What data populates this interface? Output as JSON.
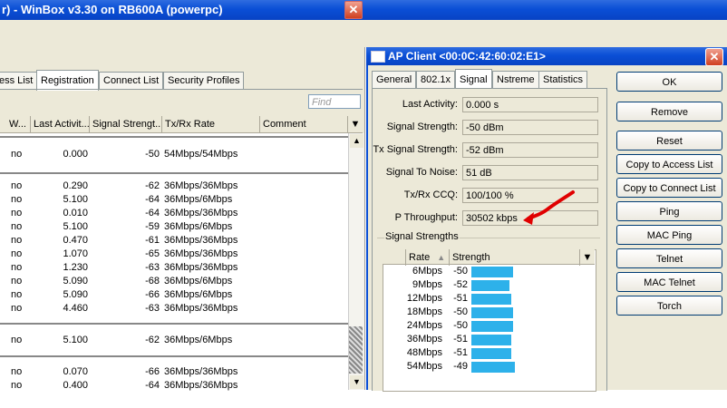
{
  "main_window": {
    "title": "r) - WinBox v3.30 on RB600A (powerpc)"
  },
  "left_window": {
    "tabs": [
      "ess List",
      "Registration",
      "Connect List",
      "Security Profiles"
    ],
    "active_tab": "Registration",
    "find_placeholder": "Find",
    "columns": [
      "W...",
      "Last Activit...",
      "Signal Strengt...",
      "Tx/Rx Rate",
      "Comment"
    ],
    "rows": [
      {
        "w": "no",
        "last": "0.000",
        "sig": "-50",
        "rate": "54Mbps/54Mbps"
      },
      {
        "w": "no",
        "last": "0.290",
        "sig": "-62",
        "rate": "36Mbps/36Mbps"
      },
      {
        "w": "no",
        "last": "5.100",
        "sig": "-64",
        "rate": "36Mbps/6Mbps"
      },
      {
        "w": "no",
        "last": "0.010",
        "sig": "-64",
        "rate": "36Mbps/36Mbps"
      },
      {
        "w": "no",
        "last": "5.100",
        "sig": "-59",
        "rate": "36Mbps/6Mbps"
      },
      {
        "w": "no",
        "last": "0.470",
        "sig": "-61",
        "rate": "36Mbps/36Mbps"
      },
      {
        "w": "no",
        "last": "1.070",
        "sig": "-65",
        "rate": "36Mbps/36Mbps"
      },
      {
        "w": "no",
        "last": "1.230",
        "sig": "-63",
        "rate": "36Mbps/36Mbps"
      },
      {
        "w": "no",
        "last": "5.090",
        "sig": "-68",
        "rate": "36Mbps/6Mbps"
      },
      {
        "w": "no",
        "last": "5.090",
        "sig": "-66",
        "rate": "36Mbps/6Mbps"
      },
      {
        "w": "no",
        "last": "4.460",
        "sig": "-63",
        "rate": "36Mbps/36Mbps"
      },
      {
        "w": "no",
        "last": "5.100",
        "sig": "-62",
        "rate": "36Mbps/6Mbps"
      },
      {
        "w": "no",
        "last": "0.070",
        "sig": "-66",
        "rate": "36Mbps/36Mbps"
      },
      {
        "w": "no",
        "last": "0.400",
        "sig": "-64",
        "rate": "36Mbps/36Mbps"
      }
    ]
  },
  "ap_window": {
    "title": "AP Client <00:0C:42:60:02:E1>",
    "tabs": [
      "General",
      "802.1x",
      "Signal",
      "Nstreme",
      "Statistics"
    ],
    "active_tab": "Signal",
    "fields": [
      {
        "label": "Last Activity:",
        "value": "0.000 s"
      },
      {
        "label": "Signal Strength:",
        "value": "-50 dBm"
      },
      {
        "label": "Tx Signal Strength:",
        "value": "-52 dBm"
      },
      {
        "label": "Signal To Noise:",
        "value": "51 dB"
      },
      {
        "label": "Tx/Rx CCQ:",
        "value": "100/100 %"
      },
      {
        "label": "P Throughput:",
        "value": "30502 kbps"
      }
    ],
    "signal_strengths_label": "Signal Strengths",
    "ss_columns": [
      "Rate",
      "Strength"
    ],
    "ss_rows": [
      {
        "rate": "6Mbps",
        "strength": "-50",
        "level": -50
      },
      {
        "rate": "9Mbps",
        "strength": "-52",
        "level": -52
      },
      {
        "rate": "12Mbps",
        "strength": "-51",
        "level": -51
      },
      {
        "rate": "18Mbps",
        "strength": "-50",
        "level": -50
      },
      {
        "rate": "24Mbps",
        "strength": "-50",
        "level": -50
      },
      {
        "rate": "36Mbps",
        "strength": "-51",
        "level": -51
      },
      {
        "rate": "48Mbps",
        "strength": "-51",
        "level": -51
      },
      {
        "rate": "54Mbps",
        "strength": "-49",
        "level": -49
      }
    ],
    "buttons": [
      "OK",
      "Remove",
      "Reset",
      "Copy to Access List",
      "Copy to Connect List",
      "Ping",
      "MAC Ping",
      "Telnet",
      "MAC Telnet",
      "Torch"
    ],
    "bar_color": "#2db1ea"
  },
  "colors": {
    "titlebar": "#0a4fd6",
    "annotation_arrow": "#e00000"
  }
}
